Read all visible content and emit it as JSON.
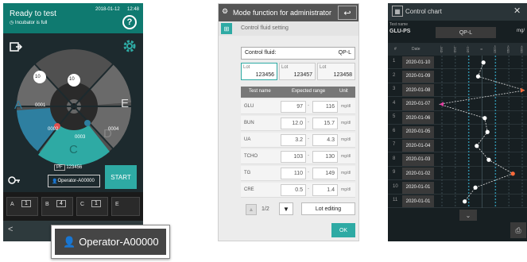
{
  "screen1": {
    "title": "Ready to test",
    "date": "2018-01-12",
    "time": "12:48",
    "status": "Incubator is full",
    "help": "?",
    "sections": [
      "A",
      "B",
      "C",
      "D",
      "E"
    ],
    "slots": [
      "10",
      "10",
      "0001",
      "0002",
      "0003",
      "0004"
    ],
    "pf_label": "PF",
    "pf_value": "123456",
    "operator": "Operator-A00000",
    "start_label": "START",
    "panels": [
      {
        "letter": "A",
        "value": "1"
      },
      {
        "letter": "B",
        "value": "4"
      },
      {
        "letter": "C",
        "value": "1"
      },
      {
        "letter": "E",
        "value": ""
      }
    ]
  },
  "callout": {
    "operator": "Operator-A00000"
  },
  "screen2": {
    "title": "Mode function for administrator",
    "subtitle": "Control fluid setting",
    "control_fluid_label": "Control fluid:",
    "control_fluid_value": "QP-L",
    "lots": [
      {
        "label": "Lot",
        "value": "123456"
      },
      {
        "label": "Lot",
        "value": "123457"
      },
      {
        "label": "Lot",
        "value": "123458"
      }
    ],
    "columns": [
      "Test name",
      "Expected range",
      "Unit"
    ],
    "rows": [
      {
        "name": "GLU",
        "low": "97",
        "high": "116",
        "unit": "mg/dl"
      },
      {
        "name": "BUN",
        "low": "12.0",
        "high": "15.7",
        "unit": "mg/dl"
      },
      {
        "name": "UA",
        "low": "3.2",
        "high": "4.3",
        "unit": "mg/dl"
      },
      {
        "name": "TCHO",
        "low": "103",
        "high": "130",
        "unit": "mg/dl"
      },
      {
        "name": "TG",
        "low": "110",
        "high": "149",
        "unit": "mg/dl"
      },
      {
        "name": "CRE",
        "low": "0.5",
        "high": "1.4",
        "unit": "mg/dl"
      }
    ],
    "page": "1/2",
    "lot_editing": "Lot editing",
    "ok": "OK"
  },
  "screen3": {
    "title": "Control chart",
    "test_label": "Test name",
    "test_name": "GLU-PS",
    "fluid": "QP-L",
    "unit": "mg/",
    "col_no": "#",
    "col_date": "Date",
    "axis_ticks": [
      "-3SD",
      "-2SD",
      "-1SD",
      "0",
      "+1SD",
      "+2SD",
      "+3SD"
    ],
    "rows": [
      {
        "no": "1",
        "date": "2020-01-10"
      },
      {
        "no": "2",
        "date": "2020-01-09"
      },
      {
        "no": "3",
        "date": "2020-01-08"
      },
      {
        "no": "4",
        "date": "2020-01-07"
      },
      {
        "no": "5",
        "date": "2020-01-06"
      },
      {
        "no": "6",
        "date": "2020-01-05"
      },
      {
        "no": "7",
        "date": "2020-01-04"
      },
      {
        "no": "8",
        "date": "2020-01-03"
      },
      {
        "no": "9",
        "date": "2020-01-02"
      },
      {
        "no": "10",
        "date": "2020-01-01"
      },
      {
        "no": "11",
        "date": "2020-01-01"
      }
    ],
    "points_sd": [
      0.1,
      -0.3,
      3.2,
      -3.2,
      0.2,
      0.4,
      -0.4,
      0.5,
      2.3,
      -0.5,
      -1.3
    ],
    "colors": {
      "normal": "#ffffff",
      "outlier": "#ff6a3a",
      "low_outlier": "#e040a0",
      "range": "#2e8ba3"
    }
  }
}
